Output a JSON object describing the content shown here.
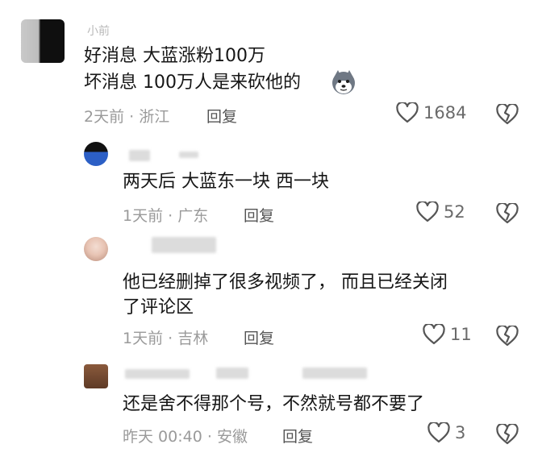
{
  "comments": [
    {
      "username": "小前",
      "lines": [
        "好消息 大蓝涨粉100万",
        "坏消息 100万人是来砍他的"
      ],
      "emoji": "husky-emoji",
      "time": "2天前",
      "location": "浙江",
      "reply_label": "回复",
      "likes": "1684"
    },
    {
      "username": "",
      "lines": [
        "两天后 大蓝东一块 西一块"
      ],
      "time": "1天前",
      "location": "广东",
      "reply_label": "回复",
      "likes": "52"
    },
    {
      "username": "",
      "lines": [
        "他已经删掉了很多视频了， 而且已经关闭",
        "了评论区"
      ],
      "time": "1天前",
      "location": "吉林",
      "reply_label": "回复",
      "likes": "11"
    },
    {
      "username": "",
      "lines": [
        "还是舍不得那个号，不然就号都不要了"
      ],
      "time": "昨天 00:40",
      "location": "安徽",
      "reply_label": "回复",
      "likes": "3"
    }
  ],
  "separator": "·",
  "icons": {
    "like": "heart-outline-icon",
    "dislike": "broken-heart-icon"
  },
  "colors": {
    "text": "#161616",
    "meta": "#9a9a9a",
    "icon": "#555555"
  }
}
